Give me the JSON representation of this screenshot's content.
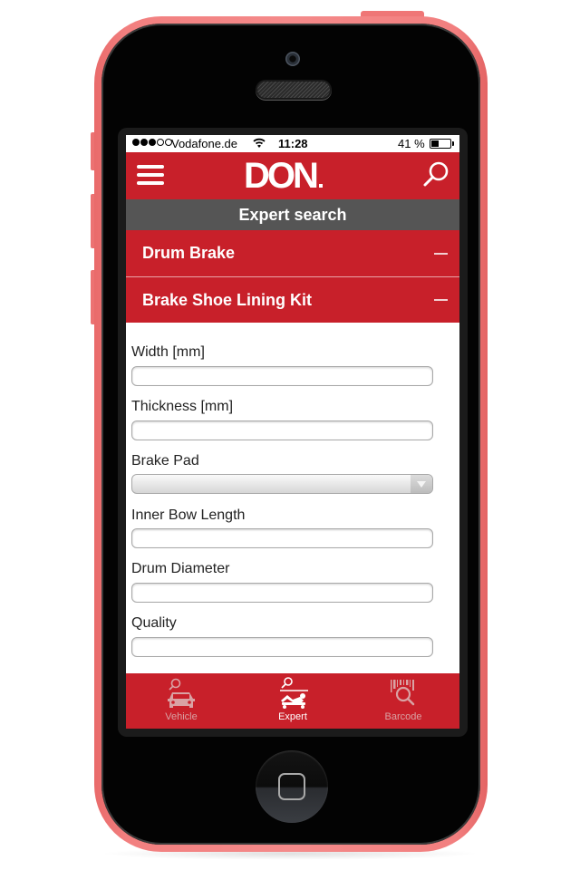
{
  "status_bar": {
    "signal_bars_filled": 3,
    "signal_bars_total": 5,
    "carrier": "Vodafone.de",
    "time": "11:28",
    "battery_percent_label": "41 %",
    "battery_level": 0.41
  },
  "header": {
    "logo": "DON",
    "menu_icon": "hamburger-menu-icon",
    "search_icon": "search-icon"
  },
  "subtitle": "Expert search",
  "accordions": [
    {
      "label": "Drum Brake",
      "state": "expanded",
      "icon": "minus-icon"
    },
    {
      "label": "Brake Shoe Lining Kit",
      "state": "expanded",
      "icon": "minus-icon"
    }
  ],
  "form": {
    "fields": [
      {
        "label": "Width [mm]",
        "type": "text",
        "value": "",
        "placeholder": ""
      },
      {
        "label": "Thickness [mm]",
        "type": "text",
        "value": "",
        "placeholder": ""
      },
      {
        "label": "Brake Pad",
        "type": "select",
        "value": ""
      },
      {
        "label": "Inner Bow Length",
        "type": "text",
        "value": "",
        "placeholder": ""
      },
      {
        "label": "Drum Diameter",
        "type": "text",
        "value": "",
        "placeholder": ""
      },
      {
        "label": "Quality",
        "type": "text",
        "value": "",
        "placeholder": ""
      }
    ]
  },
  "tab_bar": {
    "tabs": [
      {
        "label": "Vehicle",
        "icon": "vehicle-search-icon",
        "active": false
      },
      {
        "label": "Expert",
        "icon": "expert-search-icon",
        "active": true
      },
      {
        "label": "Barcode",
        "icon": "barcode-search-icon",
        "active": false
      }
    ]
  },
  "colors": {
    "brand_red": "#c8202a",
    "subtitle_gray": "#555555",
    "phone_case": "#f48a8a",
    "tab_inactive": "#d9a2a4"
  }
}
